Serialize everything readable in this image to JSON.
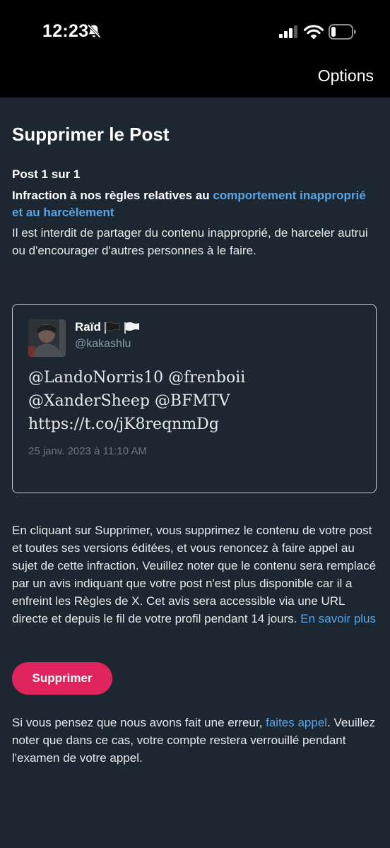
{
  "status_bar": {
    "time": "12:23"
  },
  "header": {
    "options_label": "Options"
  },
  "page": {
    "title": "Supprimer le Post",
    "post_count": "Post 1 sur 1",
    "rule_prefix": "Infraction à nos règles relatives au ",
    "rule_link": "comportement inapproprié et au harcèlement",
    "rule_description": "Il est interdit de partager du contenu inapproprié, de harceler autrui ou d'encourager d'autres personnes à le faire."
  },
  "post": {
    "author_name": "Raïd",
    "author_handle": "@kakashlu",
    "text_lines": [
      "@LandoNorris10 @frenboii",
      "@XanderSheep @BFMTV",
      "https://t.co/jK8reqnmDg"
    ],
    "date": "25 janv. 2023 à 11:10 AM"
  },
  "info": {
    "text": "En cliquant sur Supprimer, vous supprimez le contenu de votre post et toutes ses versions éditées, et vous renoncez à faire appel au sujet de cette infraction. Veuillez noter que le contenu sera remplacé par un avis indiquant que votre post n'est plus disponible car il a enfreint les Règles de X. Cet avis sera accessible via une URL directe et depuis le fil de votre profil pendant 14 jours. ",
    "learn_more_link": "En savoir plus"
  },
  "actions": {
    "delete_label": "Supprimer"
  },
  "appeal": {
    "prefix": "Si vous pensez que nous avons fait une erreur, ",
    "link": "faites appel",
    "suffix": ". Veuillez noter que dans ce cas, votre compte restera verrouillé pendant l'examen de votre appel."
  },
  "colors": {
    "background": "#1c2732",
    "link": "#5aa5e6",
    "delete_button": "#e0245e",
    "muted_text": "#8b98a5"
  },
  "icons": [
    "bell-off-icon",
    "signal-icon",
    "wifi-icon",
    "battery-icon",
    "black-flag-icon",
    "white-flag-icon"
  ]
}
